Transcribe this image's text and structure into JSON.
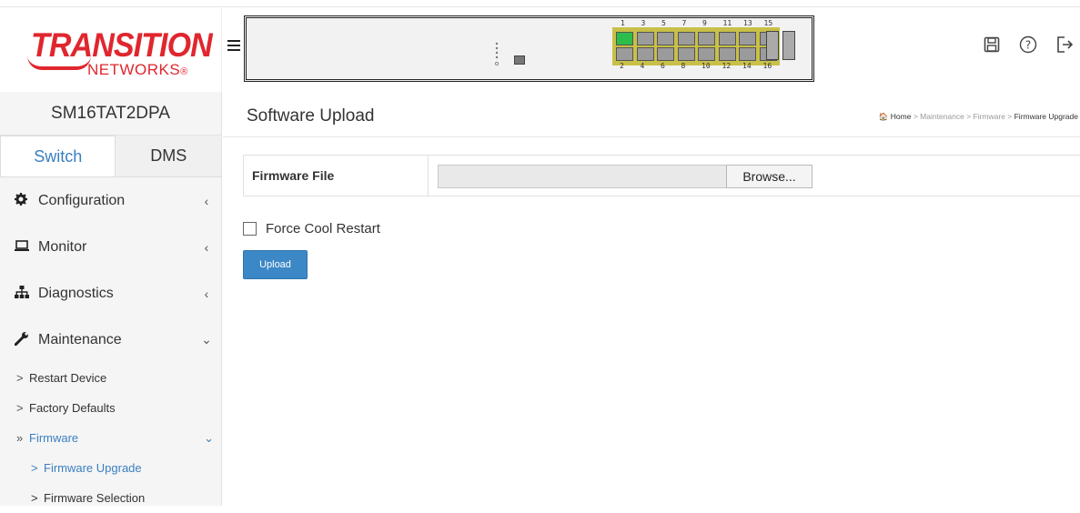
{
  "header": {
    "logo_top": "TRANSITION",
    "logo_bottom": "NETWORKS",
    "logo_reg": "®",
    "menu_icon": "hamburger-icon",
    "device_panel": {
      "port_numbers_top": [
        "1",
        "3",
        "5",
        "7",
        "9",
        "11",
        "13",
        "15"
      ],
      "port_numbers_bottom": [
        "2",
        "4",
        "6",
        "8",
        "10",
        "12",
        "14",
        "16"
      ],
      "port_up_color": "#2dbd4a"
    },
    "icons": [
      "save-icon",
      "help-icon",
      "logout-icon"
    ]
  },
  "sidebar": {
    "device_name": "SM16TAT2DPA",
    "tabs": [
      {
        "label": "Switch",
        "active": true
      },
      {
        "label": "DMS",
        "active": false
      }
    ],
    "menu": [
      {
        "label": "Configuration",
        "icon": "gear-icon",
        "arrow": "‹"
      },
      {
        "label": "Monitor",
        "icon": "laptop-icon",
        "arrow": "‹"
      },
      {
        "label": "Diagnostics",
        "icon": "sitemap-icon",
        "arrow": "‹"
      },
      {
        "label": "Maintenance",
        "icon": "wrench-icon",
        "arrow": "⌄"
      }
    ],
    "maintenance_items": [
      {
        "label": "Restart Device",
        "caret": ">"
      },
      {
        "label": "Factory Defaults",
        "caret": ">"
      },
      {
        "label": "Firmware",
        "caret": "»",
        "arrow": "⌄"
      }
    ],
    "firmware_items": [
      {
        "label": "Firmware Upgrade",
        "caret": ">"
      },
      {
        "label": "Firmware Selection",
        "caret": ">"
      }
    ]
  },
  "main": {
    "title": "Software Upload",
    "breadcrumb": {
      "home": "Home",
      "sep": " > ",
      "items": [
        "Maintenance",
        "Firmware"
      ],
      "current": "Firmware Upgrade"
    },
    "firmware_file_label": "Firmware File",
    "browse_label": "Browse...",
    "force_cool_restart_label": "Force Cool Restart",
    "force_cool_restart_checked": false,
    "upload_label": "Upload"
  },
  "colors": {
    "accent": "#3a7fc1",
    "button": "#3c88c6",
    "brand": "#e0262e"
  }
}
